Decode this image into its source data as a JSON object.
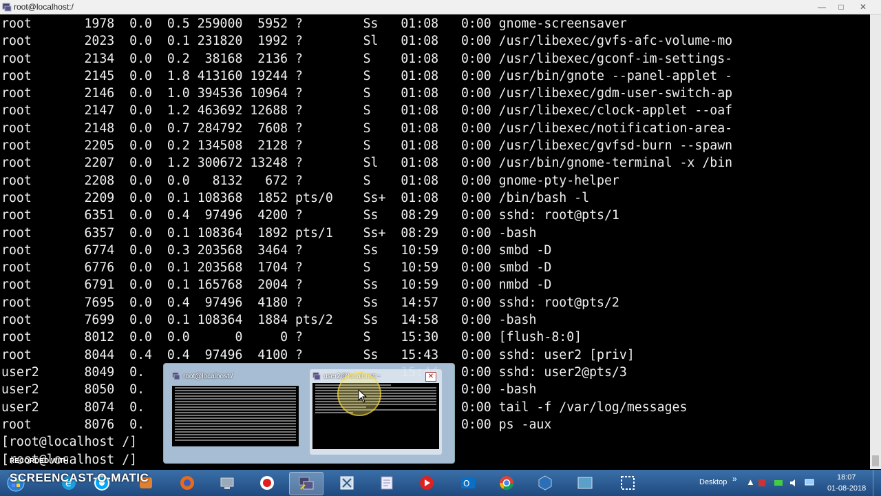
{
  "window": {
    "title": "root@localhost:/",
    "controls": [
      "minimize",
      "maximize",
      "close"
    ]
  },
  "terminal": {
    "lines": [
      "root       1978  0.0  0.5 259000  5952 ?        Ss   01:08   0:00 gnome-screensaver",
      "root       2023  0.0  0.1 231820  1992 ?        Sl   01:08   0:00 /usr/libexec/gvfs-afc-volume-mo",
      "root       2134  0.0  0.2  38168  2136 ?        S    01:08   0:00 /usr/libexec/gconf-im-settings-",
      "root       2145  0.0  1.8 413160 19244 ?        S    01:08   0:00 /usr/bin/gnote --panel-applet -",
      "root       2146  0.0  1.0 394536 10964 ?        S    01:08   0:00 /usr/libexec/gdm-user-switch-ap",
      "root       2147  0.0  1.2 463692 12688 ?        S    01:08   0:00 /usr/libexec/clock-applet --oaf",
      "root       2148  0.0  0.7 284792  7608 ?        S    01:08   0:00 /usr/libexec/notification-area-",
      "root       2205  0.0  0.2 134508  2128 ?        S    01:08   0:00 /usr/libexec/gvfsd-burn --spawn",
      "root       2207  0.0  1.2 300672 13248 ?        Sl   01:08   0:00 /usr/bin/gnome-terminal -x /bin",
      "root       2208  0.0  0.0   8132   672 ?        S    01:08   0:00 gnome-pty-helper",
      "root       2209  0.0  0.1 108368  1852 pts/0    Ss+  01:08   0:00 /bin/bash -l",
      "root       6351  0.0  0.4  97496  4200 ?        Ss   08:29   0:00 sshd: root@pts/1",
      "root       6357  0.0  0.1 108364  1892 pts/1    Ss+  08:29   0:00 -bash",
      "root       6774  0.0  0.3 203568  3464 ?        Ss   10:59   0:00 smbd -D",
      "root       6776  0.0  0.1 203568  1704 ?        S    10:59   0:00 smbd -D",
      "root       6791  0.0  0.1 165768  2004 ?        Ss   10:59   0:00 nmbd -D",
      "root       7695  0.0  0.4  97496  4180 ?        Ss   14:57   0:00 sshd: root@pts/2",
      "root       7699  0.0  0.1 108364  1884 pts/2    Ss   14:58   0:00 -bash",
      "root       8012  0.0  0.0      0     0 ?        S    15:30   0:00 [flush-8:0]",
      "root       8044  0.4  0.4  97496  4100 ?        Ss   15:43   0:00 sshd: user2 [priv]",
      "user2      8049  0.                                  15:44   0:00 sshd: user2@pts/3",
      "user2      8050  0.                                  15:44   0:00 -bash",
      "user2      8074  0.                                  15:44   0:00 tail -f /var/log/messages",
      "root       8076  0.                                  15:44   0:00 ps -aux",
      "[root@localhost /]",
      "[root@localhost /]"
    ]
  },
  "preview": {
    "windows": [
      {
        "title": "root@localhost:/"
      },
      {
        "title": "user2@localhost:~"
      }
    ]
  },
  "taskbar": {
    "desktop_label": "Desktop",
    "time": "18:07",
    "date": "01-08-2018",
    "icons": [
      "ie-icon",
      "screencast-icon",
      "firefox-icon",
      "app-icon",
      "record-icon",
      "putty-icon",
      "tools-icon",
      "notepad-icon",
      "media-icon",
      "outlook-icon",
      "chrome-icon",
      "virtualbox-icon",
      "terminal-icon",
      "snipping-icon"
    ]
  },
  "watermark": {
    "small": "RECORDED WITH",
    "large": "SCREENCAST-O-MATIC"
  }
}
